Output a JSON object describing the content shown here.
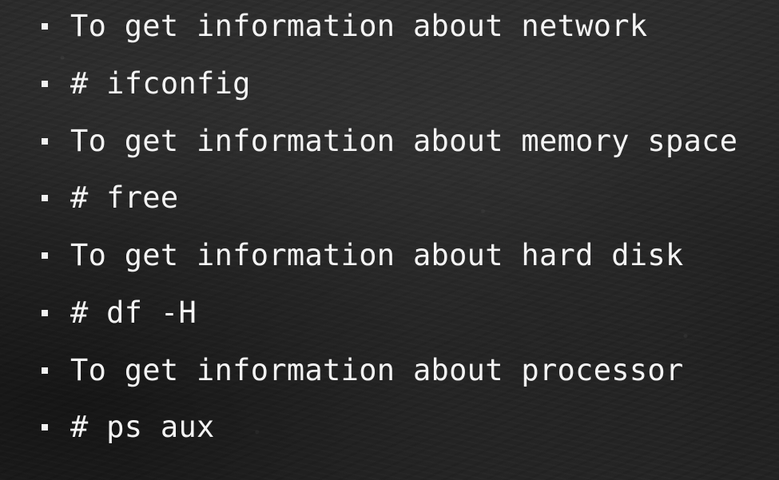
{
  "slide": {
    "bullets": [
      {
        "text": "To get information about network"
      },
      {
        "text": "# ifconfig"
      },
      {
        "text": "To get information about memory space"
      },
      {
        "text": "# free"
      },
      {
        "text": "To get information about hard disk"
      },
      {
        "text": "# df -H"
      },
      {
        "text": "To get information about processor"
      },
      {
        "text": "# ps aux"
      }
    ]
  },
  "colors": {
    "background": "#1f1f1f",
    "text": "#f4f4f4"
  }
}
